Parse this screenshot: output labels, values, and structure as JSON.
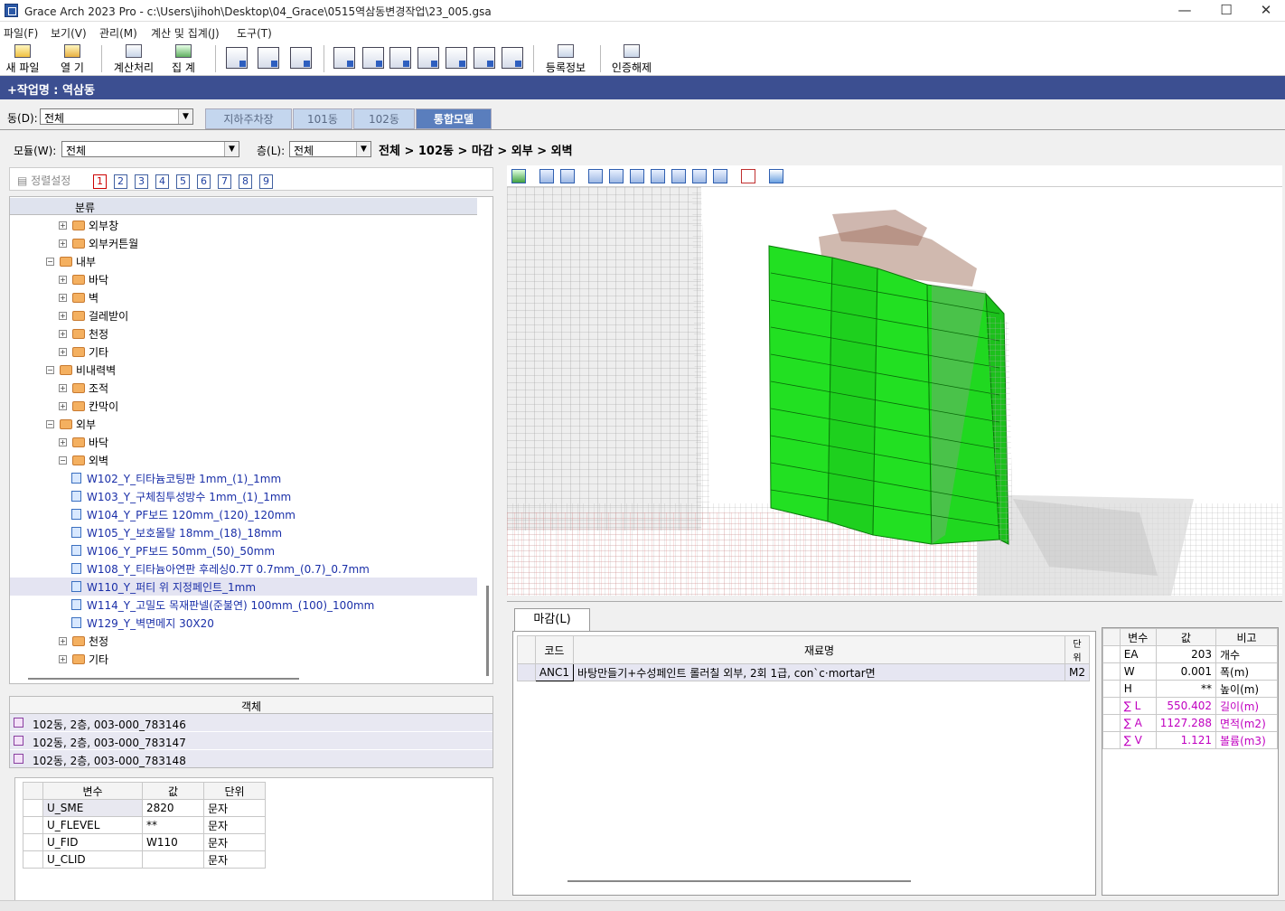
{
  "window": {
    "title": "Grace Arch 2023 Pro - c:\\Users\\jihoh\\Desktop\\04_Grace\\0515역삼동변경작업\\23_005.gsa",
    "minimize": "—",
    "maximize": "☐",
    "close": "✕"
  },
  "menu": [
    "파일(F)",
    "보기(V)",
    "관리(M)",
    "계산 및 집계(J)",
    "도구(T)"
  ],
  "toolbar": {
    "new_file": "새 파일",
    "open": "열  기",
    "calc": "계산처리",
    "aggregate": "집  계",
    "register": "등록정보",
    "unauth": "인증해제"
  },
  "work_name": "+작업명 : 역삼동",
  "filters": {
    "dong_label": "동(D):",
    "dong_value": "전체",
    "module_label": "모듈(W):",
    "module_value": "전체",
    "floor_label": "층(L):",
    "floor_value": "전체"
  },
  "tabs": [
    "지하주차장",
    "101동",
    "102동",
    "통합모델"
  ],
  "breadcrumb": "전체 > 102동 > 마감 > 외부 > 외벽",
  "sort": {
    "label": "정렬설정",
    "numbers": [
      "1",
      "2",
      "3",
      "4",
      "5",
      "6",
      "7",
      "8",
      "9"
    ]
  },
  "tree": {
    "header": "분류",
    "items": [
      {
        "label": "외부창",
        "type": "folder",
        "level": 2
      },
      {
        "label": "외부커튼월",
        "type": "folder",
        "level": 2
      },
      {
        "label": "내부",
        "type": "folder",
        "level": 1,
        "expanded": true
      },
      {
        "label": "바닥",
        "type": "folder",
        "level": 2
      },
      {
        "label": "벽",
        "type": "folder",
        "level": 2
      },
      {
        "label": "걸레받이",
        "type": "folder",
        "level": 2
      },
      {
        "label": "천정",
        "type": "folder",
        "level": 2
      },
      {
        "label": "기타",
        "type": "folder",
        "level": 2
      },
      {
        "label": "비내력벽",
        "type": "folder",
        "level": 1,
        "expanded": true
      },
      {
        "label": "조적",
        "type": "folder",
        "level": 2
      },
      {
        "label": "칸막이",
        "type": "folder",
        "level": 2
      },
      {
        "label": "외부",
        "type": "folder",
        "level": 1,
        "expanded": true
      },
      {
        "label": "바닥",
        "type": "folder",
        "level": 2
      },
      {
        "label": "외벽",
        "type": "folder",
        "level": 2,
        "expanded": true
      },
      {
        "label": "W102_Y_티타늄코팅판 1mm_(1)_1mm",
        "type": "leaf",
        "level": 3
      },
      {
        "label": "W103_Y_구체침투성방수 1mm_(1)_1mm",
        "type": "leaf",
        "level": 3
      },
      {
        "label": "W104_Y_PF보드 120mm_(120)_120mm",
        "type": "leaf",
        "level": 3
      },
      {
        "label": "W105_Y_보호몰탈 18mm_(18)_18mm",
        "type": "leaf",
        "level": 3
      },
      {
        "label": "W106_Y_PF보드 50mm_(50)_50mm",
        "type": "leaf",
        "level": 3
      },
      {
        "label": "W108_Y_티타늄아연판 후레싱0.7T 0.7mm_(0.7)_0.7mm",
        "type": "leaf",
        "level": 3
      },
      {
        "label": "W110_Y_퍼티 위 지정페인트_1mm",
        "type": "leaf",
        "level": 3,
        "selected": true
      },
      {
        "label": "W114_Y_고밀도 목재판넬(준불연) 100mm_(100)_100mm",
        "type": "leaf",
        "level": 3
      },
      {
        "label": "W129_Y_벽면메지 30X20",
        "type": "leaf",
        "level": 3
      },
      {
        "label": "천정",
        "type": "folder",
        "level": 2
      },
      {
        "label": "기타",
        "type": "folder",
        "level": 2
      }
    ]
  },
  "objects": {
    "header": "객체",
    "rows": [
      "102동, 2층, 003-000_783146",
      "102동, 2층, 003-000_783147",
      "102동, 2층, 003-000_783148"
    ]
  },
  "variables": {
    "headers": [
      "변수",
      "값",
      "단위"
    ],
    "rows": [
      {
        "name": "U_SME",
        "value": "2820",
        "unit": "문자"
      },
      {
        "name": "U_FLEVEL",
        "value": "**",
        "unit": "문자"
      },
      {
        "name": "U_FID",
        "value": "W110",
        "unit": "문자"
      },
      {
        "name": "U_CLID",
        "value": "",
        "unit": "문자"
      }
    ]
  },
  "finish_tab": "마감(L)",
  "finish": {
    "headers": [
      "코드",
      "재료명",
      "단위"
    ],
    "rows": [
      {
        "code": "ANC1",
        "name": "바탕만들기+수성페인트 롤러칠  외부, 2회 1급, con`c·mortar면",
        "unit": "M2"
      }
    ]
  },
  "summary": {
    "headers": [
      "변수",
      "값",
      "비고"
    ],
    "rows": [
      {
        "var": "EA",
        "value": "203",
        "note": "개수",
        "sum": false
      },
      {
        "var": "W",
        "value": "0.001",
        "note": "폭(m)",
        "sum": false
      },
      {
        "var": "H",
        "value": "**",
        "note": "높이(m)",
        "sum": false
      },
      {
        "var": "∑ L",
        "value": "550.402",
        "note": "길이(m)",
        "sum": true
      },
      {
        "var": "∑ A",
        "value": "1127.288",
        "note": "면적(m2)",
        "sum": true
      },
      {
        "var": "∑ V",
        "value": "1.121",
        "note": "볼륨(m3)",
        "sum": true
      }
    ]
  },
  "colors": {
    "header_bar": "#3c4f91",
    "active_tab": "#5a7ebd",
    "model_green": "#22e022",
    "tree_leaf_text": "#1a2fa8",
    "sum_text": "#c000c0"
  }
}
